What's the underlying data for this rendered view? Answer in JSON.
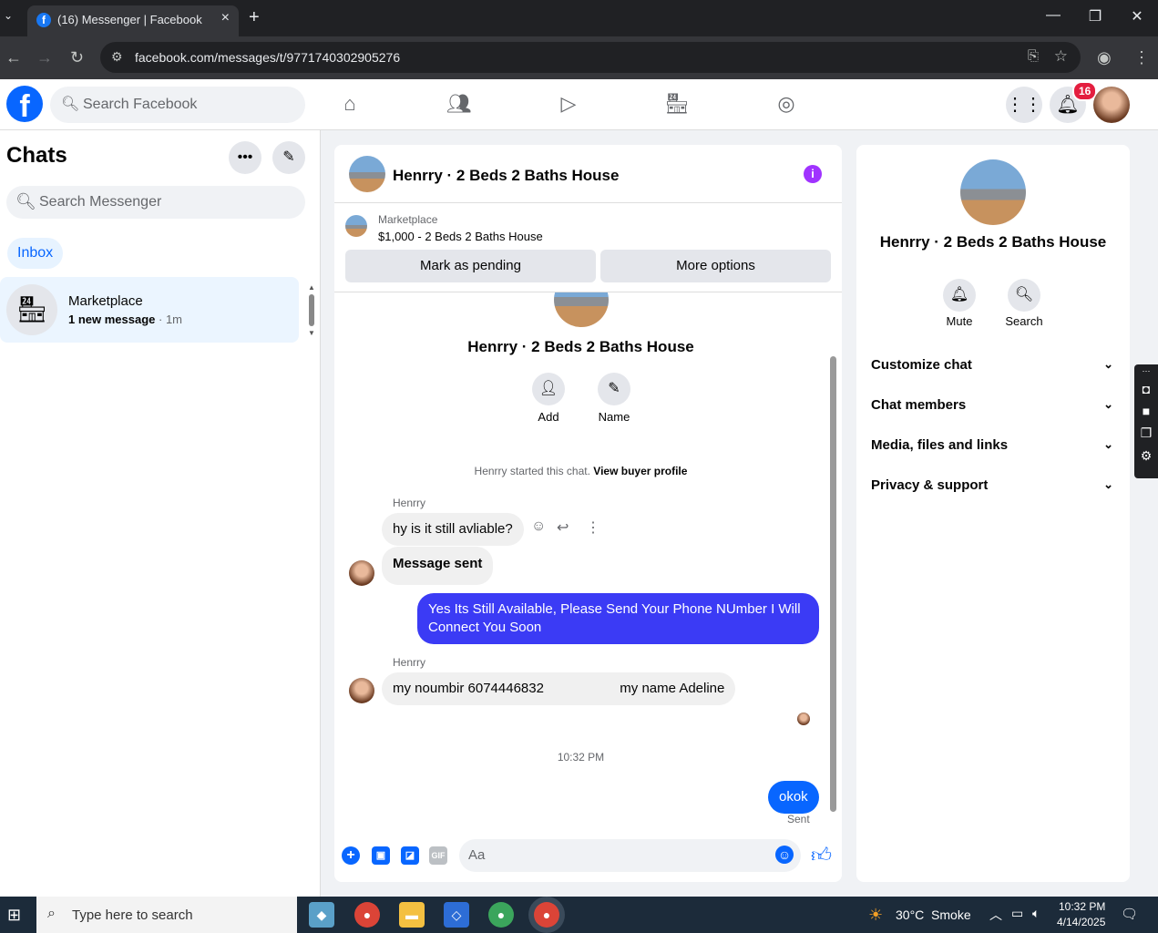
{
  "browser": {
    "tab_title": "(16) Messenger | Facebook",
    "url": "facebook.com/messages/t/9771740302905276",
    "new_tab_label": "+",
    "close_tab_label": "×"
  },
  "fb_header": {
    "logo": "f",
    "search_placeholder": "Search Facebook",
    "notification_count": "16",
    "nav_icons": [
      "home-icon",
      "friends-icon",
      "video-icon",
      "marketplace-icon",
      "groups-icon"
    ]
  },
  "left_panel": {
    "title": "Chats",
    "search_placeholder": "Search Messenger",
    "filter_label": "Inbox",
    "chats": [
      {
        "name": "Marketplace",
        "preview": "1 new message",
        "time": "· 1m"
      }
    ]
  },
  "conversation": {
    "title": "Henrry · 2 Beds 2 Baths House",
    "marketplace_label": "Marketplace",
    "listing": "$1,000 - 2 Beds 2 Baths House",
    "mark_pending_label": "Mark as pending",
    "more_options_label": "More options",
    "intro_name": "Henrry · 2 Beds 2 Baths House",
    "add_label": "Add",
    "name_label": "Name",
    "started_text": "Henrry started this chat.",
    "view_profile_label": "View buyer profile",
    "messages": [
      {
        "sender": "Henrry",
        "text": "hy is it still avliable?"
      },
      {
        "sender": "",
        "text": "Message sent"
      },
      {
        "sender": "me",
        "text": "Yes Its Still Available, Please Send Your Phone NUmber I Will Connect You Soon"
      },
      {
        "sender": "Henrry",
        "text": "my noumbir 6074446832                    my name Adeline"
      },
      {
        "sender": "me",
        "text": "okok"
      }
    ],
    "timestamp": "10:32 PM",
    "sent_status": "Sent",
    "composer_placeholder": "Aa",
    "gif_label": "GIF"
  },
  "right_panel": {
    "name": "Henrry · 2 Beds 2 Baths House",
    "mute_label": "Mute",
    "search_label": "Search",
    "sections": [
      "Customize chat",
      "Chat members",
      "Media, files and links",
      "Privacy & support"
    ]
  },
  "taskbar": {
    "search_placeholder": "Type here to search",
    "weather": "30°C  Smoke",
    "time": "10:32 PM",
    "date": "4/14/2025"
  },
  "colors": {
    "fb_blue": "#0866ff",
    "my_bubble": "#3b3bf5",
    "badge_red": "#e41e3f"
  }
}
